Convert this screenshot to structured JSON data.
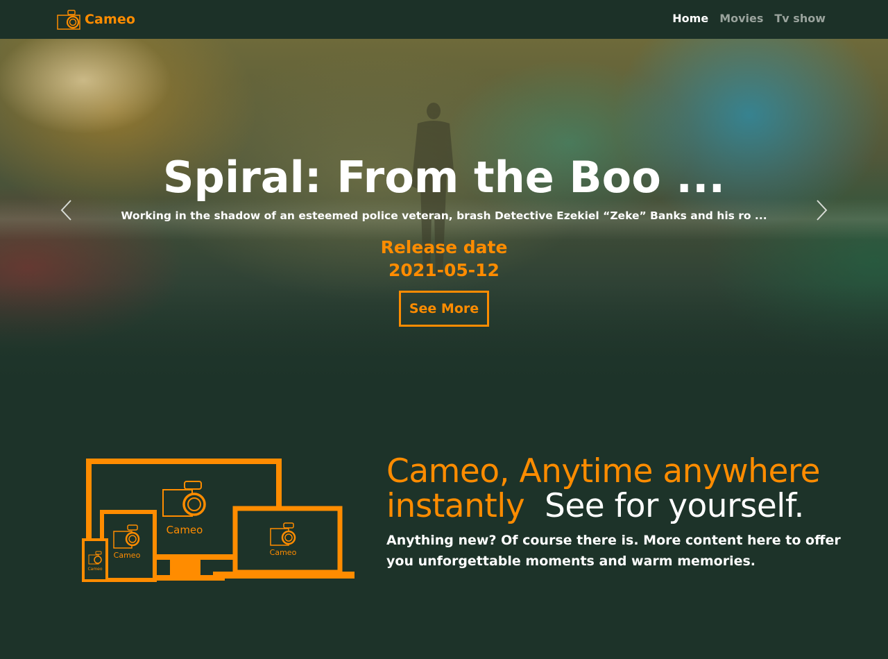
{
  "navbar": {
    "brand": "Cameo",
    "links": [
      {
        "label": "Home",
        "active": true
      },
      {
        "label": "Movies",
        "active": false
      },
      {
        "label": "Tv show",
        "active": false
      }
    ]
  },
  "hero": {
    "title": "Spiral: From the Boo ...",
    "description": "Working in the shadow of an esteemed police veteran, brash Detective Ezekiel “Zeke” Banks and his ro ...",
    "release_label": "Release date",
    "release_date": "2021-05-12",
    "see_more": "See More",
    "prev_icon": "chevron-left-icon",
    "next_icon": "chevron-right-icon"
  },
  "feature": {
    "heading_orange": "Cameo, Anytime anywhere instantly",
    "heading_white": "See for yourself.",
    "description": "Anything new? Of course there is. More content here to offer you unforgettable moments and warm memories.",
    "illustration_labels": [
      "Cameo",
      "Cameo",
      "Cameo",
      "Cameo"
    ]
  },
  "colors": {
    "accent": "#ff8c00",
    "background": "#1d3329",
    "navbar": "#1c3128",
    "text": "#ffffff",
    "nav_inactive": "#9aa39d"
  }
}
